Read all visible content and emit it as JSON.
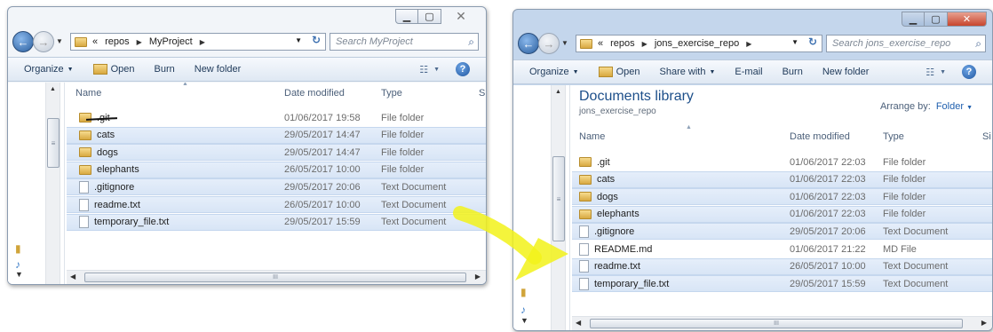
{
  "left_window": {
    "breadcrumb": [
      "«",
      "repos",
      "MyProject"
    ],
    "search_placeholder": "Search MyProject",
    "toolbar": {
      "organize": "Organize",
      "open": "Open",
      "burn": "Burn",
      "new_folder": "New folder"
    },
    "columns": {
      "name": "Name",
      "date": "Date modified",
      "type": "Type",
      "size_partial": "S"
    },
    "files": [
      {
        "name": ".git",
        "date": "01/06/2017 19:58",
        "type": "File folder",
        "kind": "folder",
        "struck": true,
        "selected": false
      },
      {
        "name": "cats",
        "date": "29/05/2017 14:47",
        "type": "File folder",
        "kind": "folder",
        "selected": true
      },
      {
        "name": "dogs",
        "date": "29/05/2017 14:47",
        "type": "File folder",
        "kind": "folder",
        "selected": true
      },
      {
        "name": "elephants",
        "date": "26/05/2017 10:00",
        "type": "File folder",
        "kind": "folder",
        "selected": true
      },
      {
        "name": ".gitignore",
        "date": "29/05/2017 20:06",
        "type": "Text Document",
        "kind": "file",
        "selected": true
      },
      {
        "name": "readme.txt",
        "date": "26/05/2017 10:00",
        "type": "Text Document",
        "kind": "file",
        "selected": true
      },
      {
        "name": "temporary_file.txt",
        "date": "29/05/2017 15:59",
        "type": "Text Document",
        "kind": "file",
        "selected": true
      }
    ],
    "hscroll_label": "III"
  },
  "right_window": {
    "breadcrumb": [
      "«",
      "repos",
      "jons_exercise_repo"
    ],
    "search_placeholder": "Search jons_exercise_repo",
    "toolbar": {
      "organize": "Organize",
      "open": "Open",
      "share_with": "Share with",
      "email": "E-mail",
      "burn": "Burn",
      "new_folder": "New folder"
    },
    "library_title": "Documents library",
    "library_subtitle": "jons_exercise_repo",
    "arrange_label": "Arrange by:",
    "arrange_value": "Folder",
    "columns": {
      "name": "Name",
      "date": "Date modified",
      "type": "Type",
      "size_partial": "Si"
    },
    "files": [
      {
        "name": ".git",
        "date": "01/06/2017 22:03",
        "type": "File folder",
        "kind": "folder",
        "selected": false
      },
      {
        "name": "cats",
        "date": "01/06/2017 22:03",
        "type": "File folder",
        "kind": "folder",
        "selected": true
      },
      {
        "name": "dogs",
        "date": "01/06/2017 22:03",
        "type": "File folder",
        "kind": "folder",
        "selected": true
      },
      {
        "name": "elephants",
        "date": "01/06/2017 22:03",
        "type": "File folder",
        "kind": "folder",
        "selected": true
      },
      {
        "name": ".gitignore",
        "date": "29/05/2017 20:06",
        "type": "Text Document",
        "kind": "file",
        "selected": true
      },
      {
        "name": "README.md",
        "date": "01/06/2017 21:22",
        "type": "MD File",
        "kind": "file",
        "selected": false
      },
      {
        "name": "readme.txt",
        "date": "26/05/2017 10:00",
        "type": "Text Document",
        "kind": "file",
        "selected": true
      },
      {
        "name": "temporary_file.txt",
        "date": "29/05/2017 15:59",
        "type": "Text Document",
        "kind": "file",
        "selected": true
      }
    ],
    "hscroll_label": "III"
  },
  "colors": {
    "highlighter": "#f2f21a",
    "selection": "#dbe7f7",
    "library_title": "#1d4f8a"
  }
}
